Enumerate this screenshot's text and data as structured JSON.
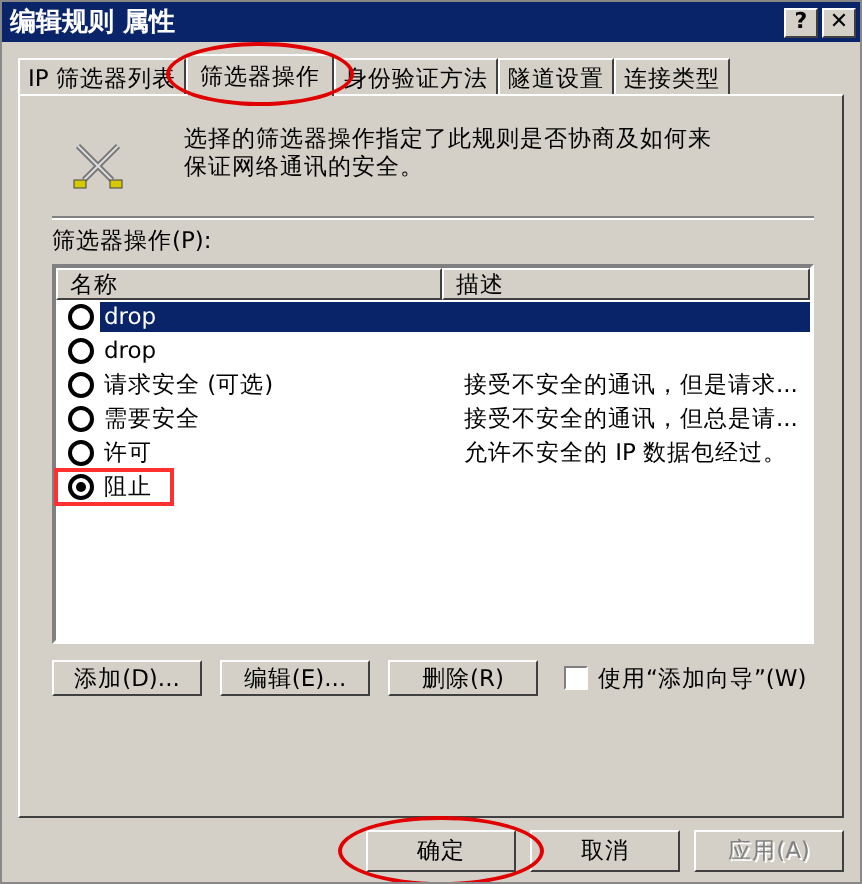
{
  "window": {
    "title": "编辑规则 属性",
    "help": "?",
    "close": "✕"
  },
  "tabs": [
    {
      "label": "IP 筛选器列表",
      "selected": false,
      "circled": false
    },
    {
      "label": "筛选器操作",
      "selected": true,
      "circled": true
    },
    {
      "label": "身份验证方法",
      "selected": false,
      "circled": false
    },
    {
      "label": "隧道设置",
      "selected": false,
      "circled": false
    },
    {
      "label": "连接类型",
      "selected": false,
      "circled": false
    }
  ],
  "intro": "选择的筛选器操作指定了此规则是否协商及如何来保证网络通讯的安全。",
  "list_label": "筛选器操作(P):",
  "table": {
    "columns": [
      "名称",
      "描述"
    ],
    "rows": [
      {
        "name": "drop",
        "description": "",
        "checked": false,
        "selected": true,
        "boxed": false
      },
      {
        "name": "drop",
        "description": "",
        "checked": false,
        "selected": false,
        "boxed": false
      },
      {
        "name": "请求安全 (可选)",
        "description": "接受不安全的通讯，但是请求...",
        "checked": false,
        "selected": false,
        "boxed": false
      },
      {
        "name": "需要安全",
        "description": "接受不安全的通讯，但总是请...",
        "checked": false,
        "selected": false,
        "boxed": false
      },
      {
        "name": "许可",
        "description": "允许不安全的 IP 数据包经过。",
        "checked": false,
        "selected": false,
        "boxed": false
      },
      {
        "name": "阻止",
        "description": "",
        "checked": true,
        "selected": false,
        "boxed": true
      }
    ]
  },
  "actions": [
    "添加(D)...",
    "编辑(E)...",
    "删除(R)"
  ],
  "wizard": {
    "label": "使用“添加向导”(W)",
    "checked": false
  },
  "buttons": [
    {
      "label": "确定",
      "disabled": false,
      "circled": true
    },
    {
      "label": "取消",
      "disabled": false,
      "circled": false
    },
    {
      "label": "应用(A)",
      "disabled": true,
      "circled": false
    }
  ]
}
